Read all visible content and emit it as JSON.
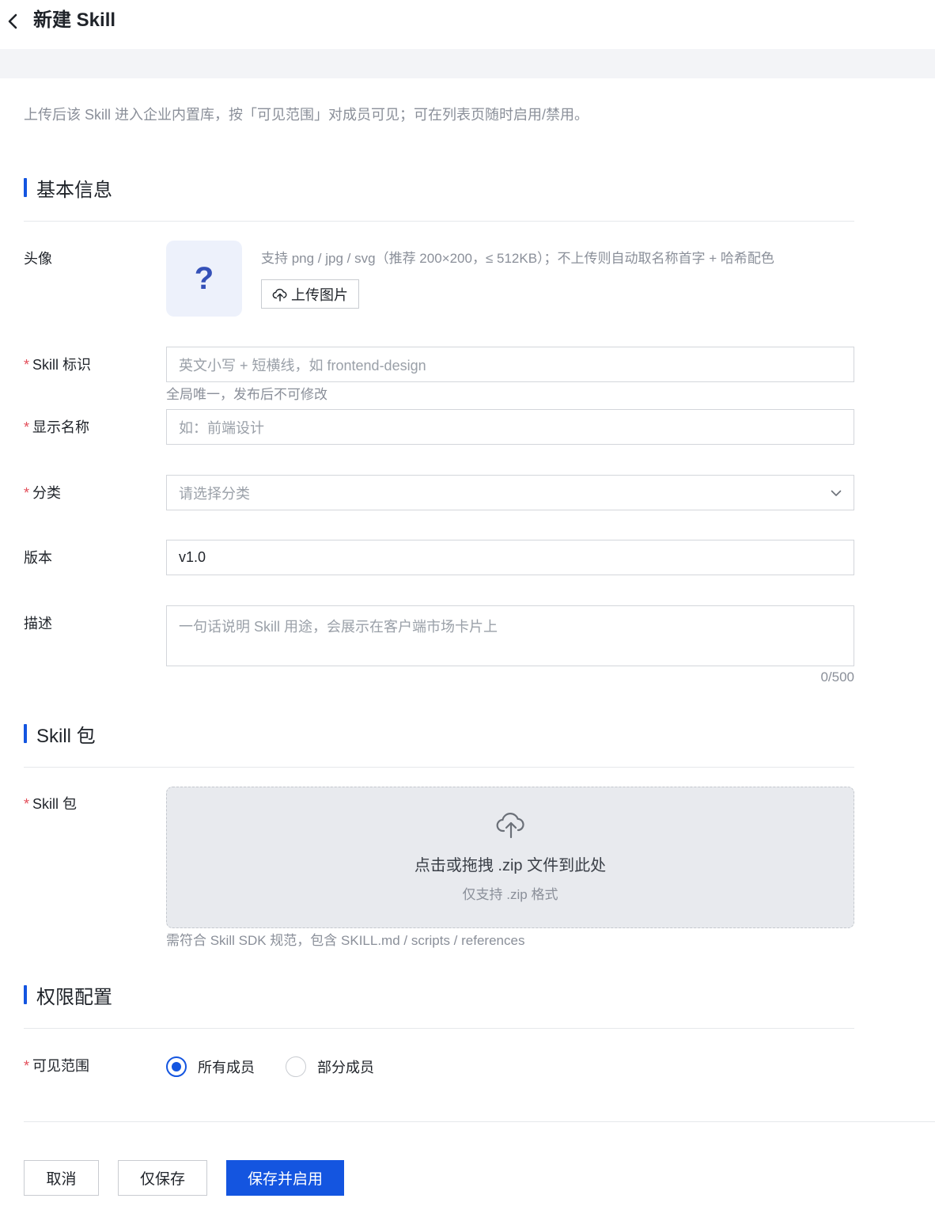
{
  "header": {
    "title": "新建 Skill"
  },
  "notice": "上传后该 Skill 进入企业内置库，按「可见范围」对成员可见；可在列表页随时启用/禁用。",
  "sections": {
    "basic": "基本信息",
    "package": "Skill 包",
    "permission": "权限配置"
  },
  "avatar": {
    "label": "头像",
    "placeholder_glyph": "?",
    "hint": "支持 png / jpg / svg（推荐 200×200，≤ 512KB）；不上传则自动取名称首字 + 哈希配色",
    "upload_label": "上传图片"
  },
  "required_mark": "*",
  "skill_id": {
    "label": "Skill 标识",
    "placeholder": "英文小写 + 短横线，如 frontend-design",
    "helper": "全局唯一，发布后不可修改"
  },
  "display_name": {
    "label": "显示名称",
    "placeholder": "如：前端设计"
  },
  "category": {
    "label": "分类",
    "placeholder": "请选择分类"
  },
  "version": {
    "label": "版本",
    "value": "v1.0"
  },
  "description": {
    "label": "描述",
    "placeholder": "一句话说明 Skill 用途，会展示在客户端市场卡片上",
    "counter": "0/500"
  },
  "package": {
    "label": "Skill 包",
    "drop_main": "点击或拖拽 .zip 文件到此处",
    "drop_sub": "仅支持 .zip 格式",
    "helper": "需符合 Skill SDK 规范，包含 SKILL.md / scripts / references"
  },
  "visibility": {
    "label": "可见范围",
    "options": [
      "所有成员",
      "部分成员"
    ],
    "selected": "所有成员"
  },
  "footer": {
    "cancel": "取消",
    "save_only": "仅保存",
    "save_enable": "保存并启用"
  },
  "colors": {
    "accent": "#1455e0",
    "required": "#e34d59",
    "avatar_bg": "#edf1fb",
    "dropzone_bg": "#e8eaee"
  }
}
